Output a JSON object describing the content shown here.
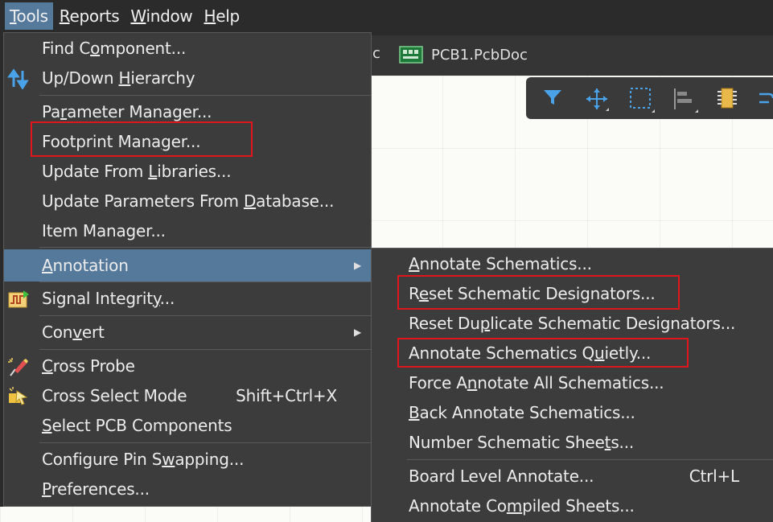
{
  "menubar": [
    {
      "pre": "",
      "key": "T",
      "post": "ools",
      "active": true
    },
    {
      "pre": "",
      "key": "R",
      "post": "eports",
      "active": false
    },
    {
      "pre": "",
      "key": "W",
      "post": "indow",
      "active": false
    },
    {
      "pre": "",
      "key": "H",
      "post": "elp",
      "active": false
    }
  ],
  "tabs": {
    "partial_label": "oc",
    "pcb_label": "PCB1.PcbDoc"
  },
  "tools_menu": {
    "find_component": {
      "pre": "Find C",
      "key": "o",
      "post": "mponent..."
    },
    "up_down_hierarchy": {
      "pre": "Up/Down ",
      "key": "H",
      "post": "ierarchy"
    },
    "parameter_manager": {
      "pre": "Pa",
      "key": "r",
      "post": "ameter Manager..."
    },
    "footprint_manager": {
      "pre": "Footprint Mana",
      "key": "g",
      "post": "er..."
    },
    "update_from_libraries": {
      "pre": "Update From ",
      "key": "L",
      "post": "ibraries..."
    },
    "update_parameters_db": {
      "pre": "Update Parameters From ",
      "key": "D",
      "post": "atabase..."
    },
    "item_manager": {
      "pre": "Item Manager...",
      "key": "",
      "post": ""
    },
    "annotation": {
      "pre": "",
      "key": "A",
      "post": "nnotation"
    },
    "signal_integrity": {
      "pre": "Signal Integrit",
      "key": "y",
      "post": "..."
    },
    "convert": {
      "pre": "Con",
      "key": "v",
      "post": "ert"
    },
    "cross_probe": {
      "pre": "",
      "key": "C",
      "post": "ross Probe"
    },
    "cross_select_mode": {
      "pre": "Cross Select Mode",
      "key": "",
      "post": "",
      "shortcut": "Shift+Ctrl+X"
    },
    "select_pcb_components": {
      "pre": "",
      "key": "S",
      "post": "elect PCB Components"
    },
    "configure_pin_swapping": {
      "pre": "Configure Pin S",
      "key": "w",
      "post": "apping..."
    },
    "preferences": {
      "pre": "",
      "key": "P",
      "post": "references..."
    }
  },
  "annotation_submenu": {
    "annotate_schematics": {
      "pre": "",
      "key": "A",
      "post": "nnotate Schematics..."
    },
    "reset_schematic_designators": {
      "pre": "R",
      "key": "e",
      "post": "set Schematic Designators..."
    },
    "reset_duplicate": {
      "pre": "Reset Du",
      "key": "p",
      "post": "licate Schematic Designators..."
    },
    "annotate_quietly": {
      "pre": "Annotate Schematics Q",
      "key": "u",
      "post": "ietly..."
    },
    "force_annotate_all": {
      "pre": "Force A",
      "key": "n",
      "post": "notate All Schematics..."
    },
    "back_annotate": {
      "pre": "",
      "key": "B",
      "post": "ack Annotate Schematics..."
    },
    "number_sheets": {
      "pre": "Number Schematic Shee",
      "key": "t",
      "post": "s..."
    },
    "board_level_annotate": {
      "pre": "Board Level Annotate...",
      "key": "",
      "post": "",
      "shortcut": "Ctrl+L"
    },
    "annotate_compiled": {
      "pre": "Annotate Co",
      "key": "m",
      "post": "piled Sheets..."
    }
  },
  "colors": {
    "highlight": "#55799b",
    "callout": "#e0161c"
  }
}
